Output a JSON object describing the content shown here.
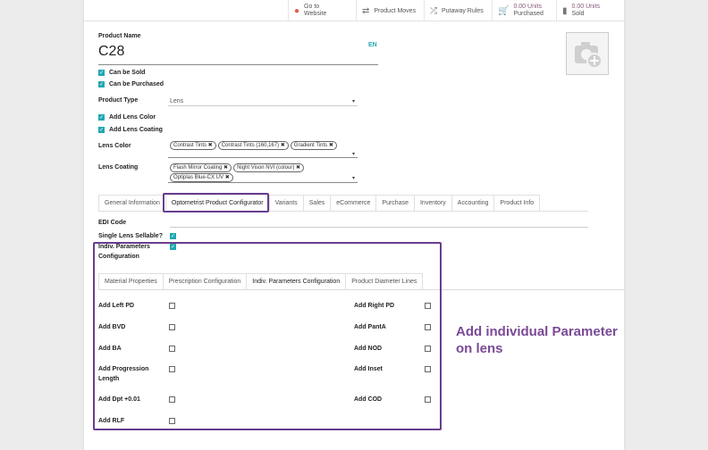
{
  "smart_buttons": [
    {
      "icon": "globe-icon",
      "label_1": "Go to",
      "label_2": "Website"
    },
    {
      "icon": "arrows-icon",
      "label_1": "Product Moves",
      "label_2": ""
    },
    {
      "icon": "shuffle-icon",
      "label_1": "Putaway Rules",
      "label_2": ""
    },
    {
      "icon": "cart-icon",
      "label_1": "0.00 Units",
      "label_2": "Purchased"
    },
    {
      "icon": "bar-chart-icon",
      "label_1": "0.00 Units",
      "label_2": "Sold"
    }
  ],
  "form": {
    "name_label": "Product Name",
    "name_value": "C28",
    "lang": "EN",
    "can_be_sold": "Can be Sold",
    "can_be_purchased": "Can be Purchased",
    "product_type_label": "Product Type",
    "product_type_value": "Lens",
    "add_lens_color": "Add Lens Color",
    "add_lens_coating": "Add Lens Coating",
    "lens_color_label": "Lens Color",
    "lens_color_tags": [
      "Contrast Tints",
      "Contrast Tints (160,167)",
      "Gradient Tints"
    ],
    "lens_coating_label": "Lens Coating",
    "lens_coating_tags_row1": [
      "Flash Mirror Coating",
      "Night Vison NVI (colour)"
    ],
    "lens_coating_tags_row2": [
      "Optiplas Blue-CX UV"
    ]
  },
  "main_tabs": [
    "General Information",
    "Optometrist Product Configurator",
    "Variants",
    "Sales",
    "eCommerce",
    "Purchase",
    "Inventory",
    "Accounting",
    "Product Info"
  ],
  "config": {
    "edi_code": "EDI Code",
    "single_lens": "Single Lens Sellable?",
    "indiv_line1": "Indiv. Parameters",
    "indiv_line2": "Configuration"
  },
  "sub_tabs": [
    "Material Properties",
    "Prescription Configuration",
    "Indiv. Parameters Configuration",
    "Product Diameter Lines"
  ],
  "params_left": [
    "Add Left PD",
    "Add BVD",
    "Add BA",
    "Add Progression",
    "Add Dpt +0.01",
    "Add RLF"
  ],
  "params_left_extra": "Length",
  "params_right": [
    "Add Right PD",
    "Add PantA",
    "Add NOD",
    "Add Inset",
    "Add COD"
  ],
  "annotation_line1": "Add individual Parameter",
  "annotation_line2": "on lens",
  "colors": {
    "accent": "#875a7b",
    "highlight": "#6a3d8f",
    "checkbox": "#21a8b0",
    "annotation": "#7a4a96"
  }
}
